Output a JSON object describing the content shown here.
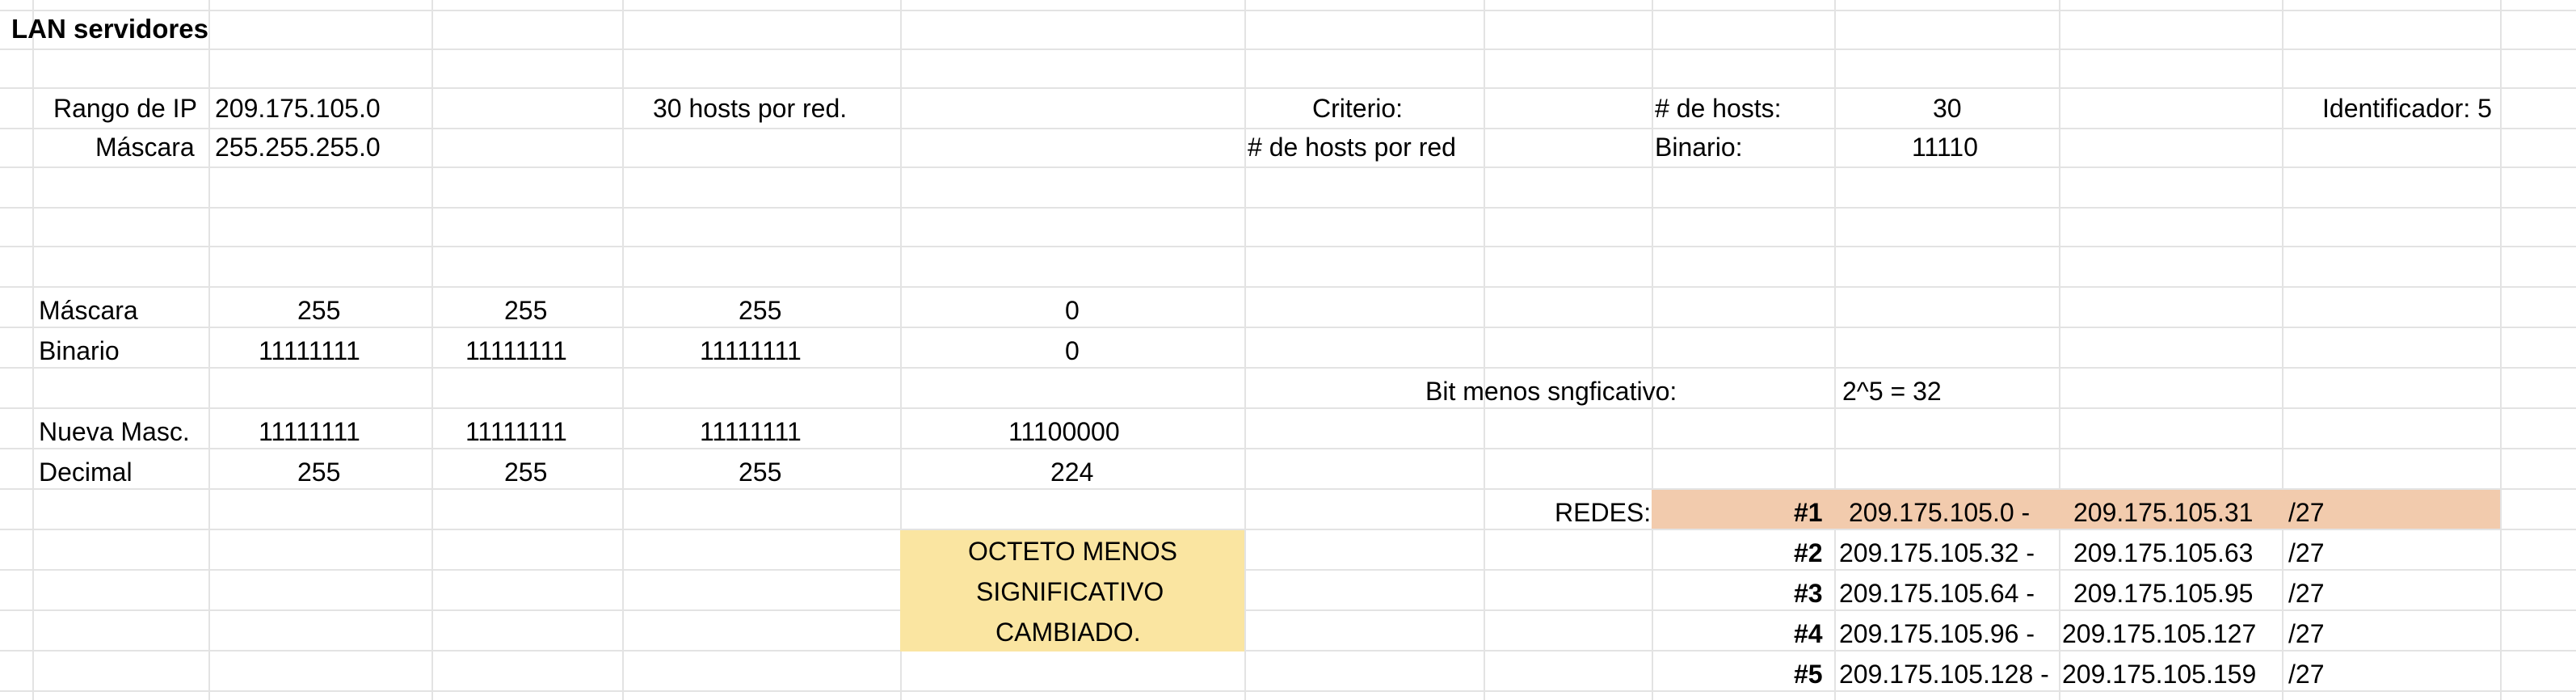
{
  "sheet": {
    "title": "LAN servidores",
    "rango_label": "Rango de IP",
    "rango_value": "209.175.105.0",
    "hosts_por_red": "30 hosts por red.",
    "mascara_label": "Máscara",
    "mascara_value": "255.255.255.0",
    "criterio_label": "Criterio:",
    "criterio_value": "# de hosts por red",
    "hosts_label": "# de hosts:",
    "hosts_value": "30",
    "binario_label": "Binario:",
    "binario_value": "11110",
    "identificador": "Identificador: 5",
    "table": {
      "rows": [
        {
          "label": "Máscara",
          "o1": "255",
          "o2": "255",
          "o3": "255",
          "o4": "0"
        },
        {
          "label": "Binario",
          "o1": "11111111",
          "o2": "11111111",
          "o3": "11111111",
          "o4": "0"
        },
        {
          "label": "Nueva Masc.",
          "o1": "11111111",
          "o2": "11111111",
          "o3": "11111111",
          "o4": "11100000"
        },
        {
          "label": "Decimal",
          "o1": "255",
          "o2": "255",
          "o3": "255",
          "o4": "224"
        }
      ]
    },
    "bit_label": "Bit menos sngficativo:",
    "bit_value": "2^5 = 32",
    "note_lines": [
      "OCTETO MENOS",
      "SIGNIFICATIVO",
      "CAMBIADO."
    ],
    "redes_label": "REDES:",
    "redes": [
      {
        "num": "#1",
        "start": "209.175.105.0 -",
        "end": "209.175.105.31",
        "prefix": "/27"
      },
      {
        "num": "#2",
        "start": "209.175.105.32 -",
        "end": "209.175.105.63",
        "prefix": "/27"
      },
      {
        "num": "#3",
        "start": "209.175.105.64 -",
        "end": "209.175.105.95",
        "prefix": "/27"
      },
      {
        "num": "#4",
        "start": "209.175.105.96 -",
        "end": "209.175.105.127",
        "prefix": "/27"
      },
      {
        "num": "#5",
        "start": "209.175.105.128 -",
        "end": "209.175.105.159",
        "prefix": "/27"
      }
    ],
    "colors": {
      "grid": "#e3e3e3",
      "note_fill": "#fae5a1",
      "redes_highlight": "#f2cbad"
    }
  }
}
